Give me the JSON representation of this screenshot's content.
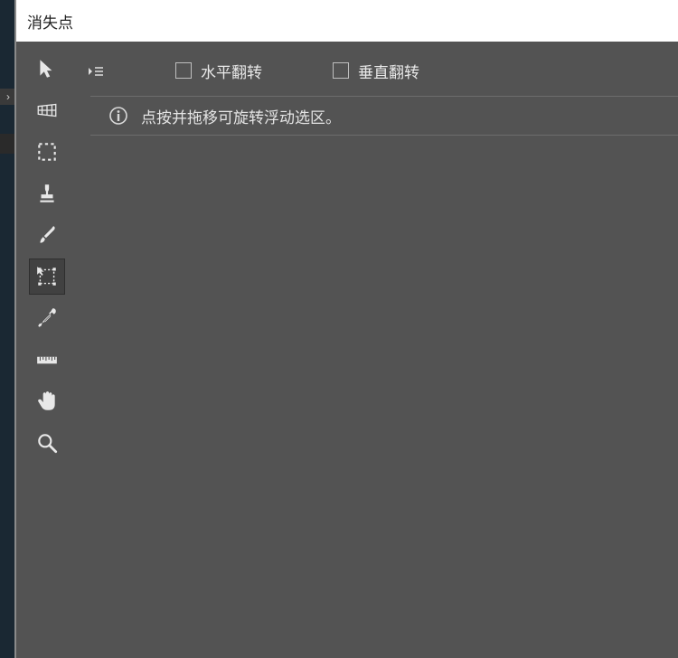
{
  "window": {
    "title": "消失点"
  },
  "options": {
    "flip_horizontal_label": "水平翻转",
    "flip_vertical_label": "垂直翻转"
  },
  "hint": {
    "text": "点按并拖移可旋转浮动选区。"
  },
  "tools": {
    "arrow": "arrow",
    "plane": "plane",
    "marquee": "marquee",
    "stamp": "stamp",
    "brush": "brush",
    "transform": "transform",
    "eyedropper": "eyedropper",
    "measure": "measure",
    "hand": "hand",
    "zoom": "zoom"
  }
}
